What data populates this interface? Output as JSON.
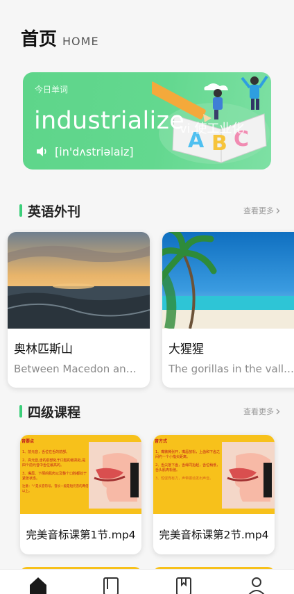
{
  "header": {
    "title": "首页",
    "subtitle": "HOME"
  },
  "daily_word": {
    "label": "今日单词",
    "word": "industrialize",
    "translation": "vi.使工业化",
    "phonetic": "[in'dʌstriəlaiz]"
  },
  "magazines": {
    "title": "英语外刊",
    "more": "查看更多",
    "items": [
      {
        "title": "奥林匹斯山",
        "desc": "Between Macedon and Thessaly there is a"
      },
      {
        "title": "大猩猩",
        "desc": "The gorillas in the valley are very"
      }
    ]
  },
  "courses": {
    "title": "四级课程",
    "more": "查看更多",
    "items": [
      {
        "title": "完美音标课第1节.mp4",
        "thumb_heading": "音要点",
        "thumb_lines": [
          "1、前元音，舌位在舌的前部。",
          "2、高元音,舌的前部处于口腔的最高处,是四个前元音中舌位最高的。",
          "3、嘴唇、下颌的肌肉以及整个口腔都处于紧张状态。"
        ],
        "thumb_note": "注意：\":\"是长音符号，音长一般是短元音的两倍以上。"
      },
      {
        "title": "完美音标课第2节.mp4",
        "thumb_heading": "音方式",
        "thumb_lines": [
          "1、嘴微微张开，嘴唇放松，上齿和下齿之间约一个小指尖距离。",
          "2、舌尖抵下齿，舌缘同抬起，舌位稍低，舌头肌肉松弛。",
          "3、短促而有力，声带振动发出声音。"
        ],
        "thumb_note": ""
      }
    ]
  },
  "colors": {
    "accent": "#3ccf7a",
    "banner": "#5ed58a",
    "course_thumb": "#f7c11b"
  },
  "tabbar": {
    "icons": [
      "home-icon",
      "book-icon",
      "bookmark-icon",
      "profile-icon"
    ],
    "active": 0
  }
}
